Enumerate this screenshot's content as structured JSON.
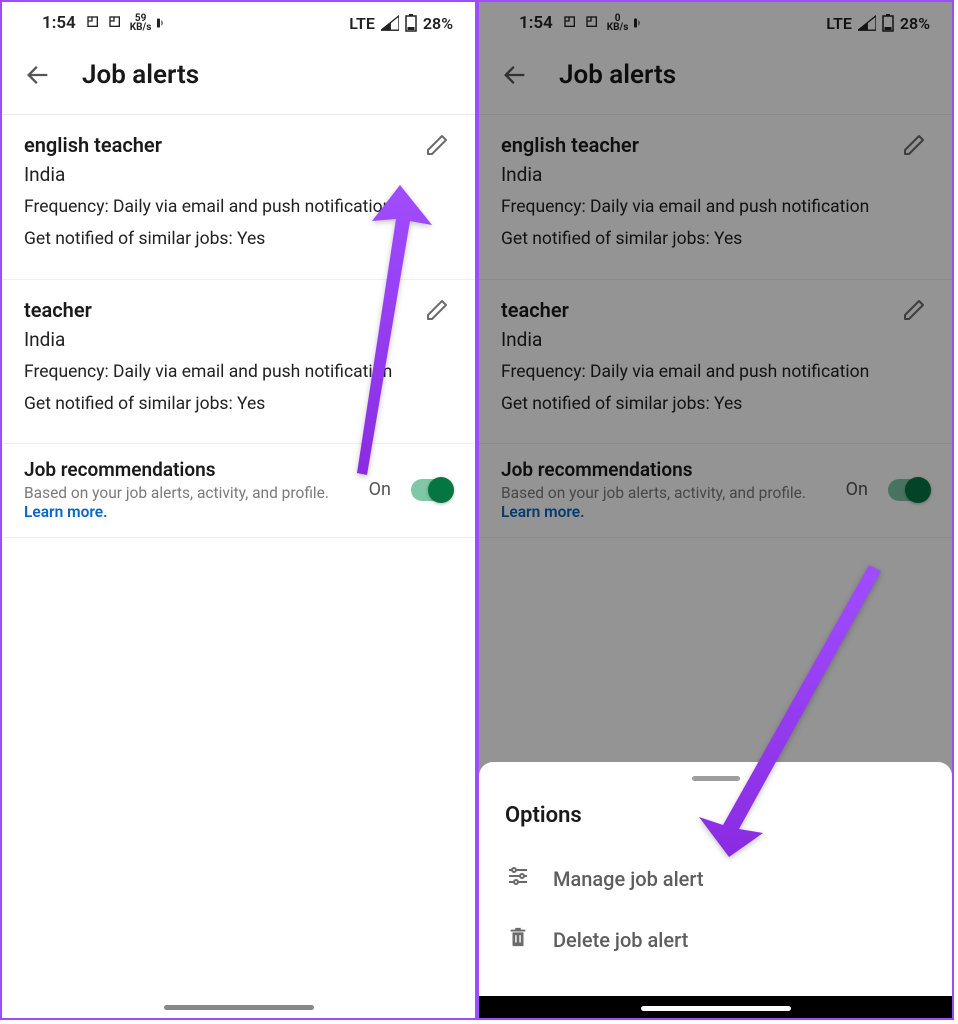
{
  "status": {
    "time": "1:54",
    "kbs_left": "59",
    "kbs_right": "0",
    "kbs_unit": "KB/s",
    "net": "LTE",
    "battery": "28%"
  },
  "header": {
    "title": "Job alerts"
  },
  "alerts": [
    {
      "title": "english teacher",
      "location": "India",
      "frequency": "Frequency: Daily via email and push notification",
      "similar": "Get notified of similar jobs: Yes"
    },
    {
      "title": "teacher",
      "location": "India",
      "frequency": "Frequency: Daily via email and push notification",
      "similar": "Get notified of similar jobs: Yes"
    }
  ],
  "recommendations": {
    "title": "Job recommendations",
    "sub": "Based on your job alerts, activity, and profile.",
    "learn": "Learn more.",
    "state": "On"
  },
  "sheet": {
    "title": "Options",
    "manage": "Manage job alert",
    "delete": "Delete job alert"
  }
}
